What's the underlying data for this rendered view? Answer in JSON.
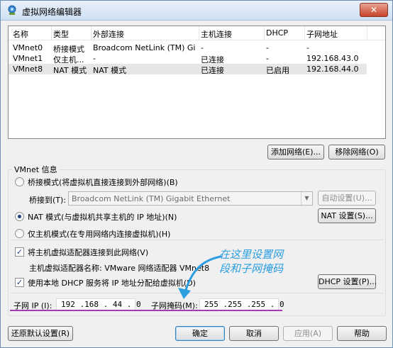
{
  "window": {
    "title": "虚拟网络编辑器",
    "close_symbol": "✕"
  },
  "network_table": {
    "columns": [
      "名称",
      "类型",
      "外部连接",
      "主机连接",
      "DHCP",
      "子网地址"
    ],
    "rows": [
      {
        "name": "VMnet0",
        "type": "桥接模式",
        "external": "Broadcom NetLink (TM) Giga...",
        "host": "-",
        "dhcp": "-",
        "subnet": "-"
      },
      {
        "name": "VMnet1",
        "type": "仅主机...",
        "external": "-",
        "host": "已连接",
        "dhcp": "-",
        "subnet": "192.168.43.0"
      },
      {
        "name": "VMnet8",
        "type": "NAT 模式",
        "external": "NAT 模式",
        "host": "已连接",
        "dhcp": "已启用",
        "subnet": "192.168.44.0"
      }
    ]
  },
  "table_buttons": {
    "add_network": "添加网络(E)...",
    "remove_network": "移除网络(O)"
  },
  "vmnet_info": {
    "group_title": "VMnet 信息",
    "bridge_mode": "桥接模式(将虚拟机直接连接到外部网络)(B)",
    "bridge_to_label": "桥接到(T):",
    "bridge_to_value": "Broadcom NetLink (TM) Gigabit Ethernet",
    "auto_settings": "自动设置(U)...",
    "nat_mode": "NAT 模式(与虚拟机共享主机的 IP 地址)(N)",
    "nat_settings": "NAT 设置(S)...",
    "host_only_mode": "仅主机模式(在专用网络内连接虚拟机)(H)",
    "selected_mode": "nat",
    "connect_adapter": "将主机虚拟适配器连接到此网络(V)",
    "connect_adapter_checked": true,
    "adapter_name": "主机虚拟适配器名称: VMware 网络适配器 VMnet8",
    "use_dhcp": "使用本地 DHCP 服务将 IP 地址分配给虚拟机(D)",
    "use_dhcp_checked": true,
    "dhcp_settings": "DHCP 设置(P)...",
    "subnet_ip_label": "子网 IP (I):",
    "subnet_ip_value": "192 .168 . 44 . 0",
    "subnet_mask_label": "子网掩码(M):",
    "subnet_mask_value": "255 .255 .255 . 0"
  },
  "annotation": {
    "line1": "在这里设置网",
    "line2": "段和子网掩码",
    "color": "#2d9ee0"
  },
  "footer": {
    "restore_defaults": "还原默认设置(R)",
    "ok": "确定",
    "cancel": "取消",
    "apply": "应用(A)",
    "help": "帮助"
  }
}
